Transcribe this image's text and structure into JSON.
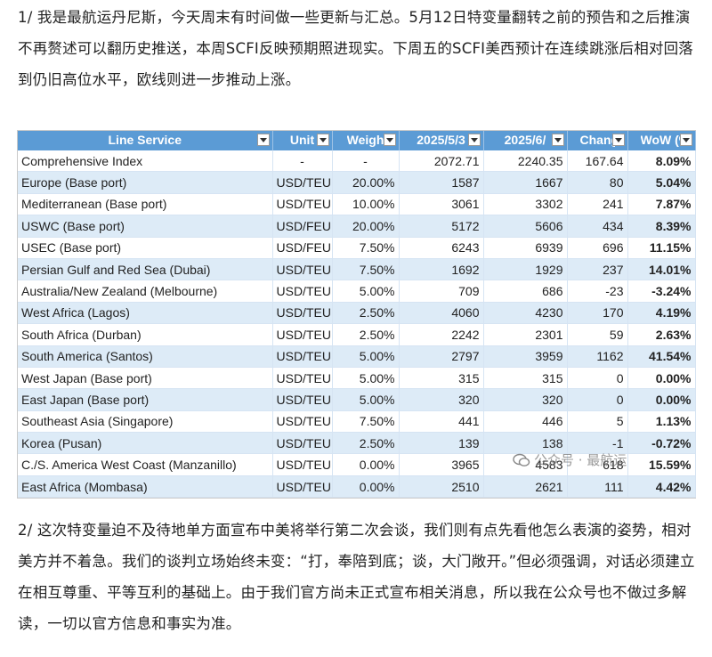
{
  "paragraphs": {
    "p1": "1/ 我是最航运丹尼斯，今天周末有时间做一些更新与汇总。5月12日特变量翻转之前的预告和之后推演不再赘述可以翻历史推送，本周SCFI反映预期照进现实。下周五的SCFI美西预计在连续跳涨后相对回落到仍旧高位水平，欧线则进一步推动上涨。",
    "p2": "2/ 这次特变量迫不及待地单方面宣布中美将举行第二次会谈，我们则有点先看他怎么表演的姿势，相对美方并不着急。我们的谈判立场始终未变：“打，奉陪到底；谈，大门敞开。”但必须强调，对话必须建立在相互尊重、平等互利的基础上。由于我们官方尚未正式宣布相关消息，所以我在公众号也不做过多解读，一切以官方信息和事实为准。"
  },
  "table": {
    "headers": [
      "Line Service",
      "Unit",
      "Weigh",
      "2025/5/3",
      "2025/6/",
      "Chang",
      "WoW (%"
    ],
    "rows": [
      [
        "Comprehensive Index",
        "-",
        "-",
        "2072.71",
        "2240.35",
        "167.64",
        "8.09%"
      ],
      [
        "Europe (Base port)",
        "USD/TEU",
        "20.00%",
        "1587",
        "1667",
        "80",
        "5.04%"
      ],
      [
        "Mediterranean (Base port)",
        "USD/TEU",
        "10.00%",
        "3061",
        "3302",
        "241",
        "7.87%"
      ],
      [
        "USWC (Base port)",
        "USD/FEU",
        "20.00%",
        "5172",
        "5606",
        "434",
        "8.39%"
      ],
      [
        "USEC (Base port)",
        "USD/FEU",
        "7.50%",
        "6243",
        "6939",
        "696",
        "11.15%"
      ],
      [
        "Persian Gulf and Red Sea (Dubai)",
        "USD/TEU",
        "7.50%",
        "1692",
        "1929",
        "237",
        "14.01%"
      ],
      [
        "Australia/New Zealand (Melbourne)",
        "USD/TEU",
        "5.00%",
        "709",
        "686",
        "-23",
        "-3.24%"
      ],
      [
        "West Africa (Lagos)",
        "USD/TEU",
        "2.50%",
        "4060",
        "4230",
        "170",
        "4.19%"
      ],
      [
        "South Africa (Durban)",
        "USD/TEU",
        "2.50%",
        "2242",
        "2301",
        "59",
        "2.63%"
      ],
      [
        "South America (Santos)",
        "USD/TEU",
        "5.00%",
        "2797",
        "3959",
        "1162",
        "41.54%"
      ],
      [
        "West Japan (Base port)",
        "USD/TEU",
        "5.00%",
        "315",
        "315",
        "0",
        "0.00%"
      ],
      [
        "East Japan (Base port)",
        "USD/TEU",
        "5.00%",
        "320",
        "320",
        "0",
        "0.00%"
      ],
      [
        "Southeast Asia (Singapore)",
        "USD/TEU",
        "7.50%",
        "441",
        "446",
        "5",
        "1.13%"
      ],
      [
        "Korea (Pusan)",
        "USD/TEU",
        "2.50%",
        "139",
        "138",
        "-1",
        "-0.72%"
      ],
      [
        "C./S. America West Coast (Manzanillo)",
        "USD/TEU",
        "0.00%",
        "3965",
        "4583",
        "618",
        "15.59%"
      ],
      [
        "East Africa (Mombasa)",
        "USD/TEU",
        "0.00%",
        "2510",
        "2621",
        "111",
        "4.42%"
      ]
    ]
  },
  "watermark": {
    "text": "公众号 · 最航运"
  },
  "colors": {
    "header_bg": "#5b9bd5",
    "band": "#ddebf7"
  }
}
